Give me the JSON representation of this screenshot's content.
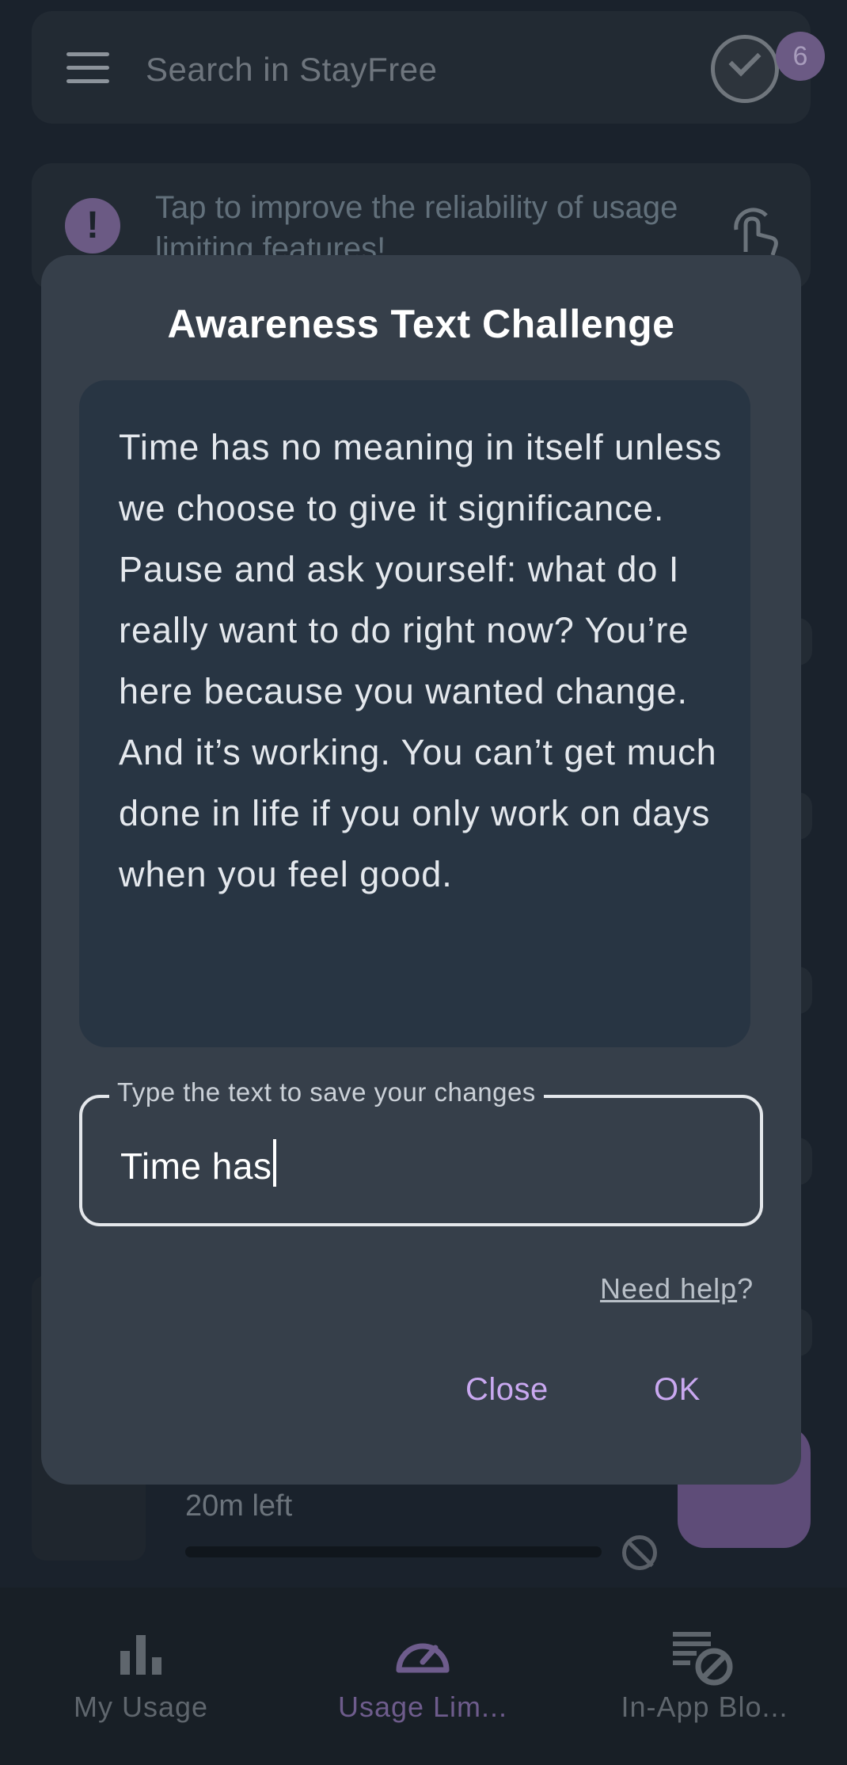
{
  "search": {
    "placeholder": "Search in StayFree",
    "badge_count": "6"
  },
  "banner": {
    "text": "Tap to improve the reliability of usage limiting features!"
  },
  "background_row": {
    "time_left": "20m left"
  },
  "dialog": {
    "title": "Awareness Text Challenge",
    "quote": "Time has no meaning in itself unless we choose to give it significance. Pause and ask yourself: what do I really want to do right now? You’re here because you wanted change. And it’s working. You can’t get much done in life if you only work on days when you feel good.",
    "field_label": "Type the text to save your changes",
    "field_value": "Time has",
    "help_link": "Need help",
    "help_suffix": "?",
    "close_label": "Close",
    "ok_label": "OK"
  },
  "bottom_nav": {
    "items": [
      {
        "label": "My Usage",
        "icon": "bar-chart-icon"
      },
      {
        "label": "Usage Lim...",
        "icon": "speedometer-icon",
        "active": true
      },
      {
        "label": "In-App Blo...",
        "icon": "list-block-icon"
      }
    ]
  },
  "colors": {
    "accent": "#c9a8f0",
    "dialog_bg": "#363f4a",
    "quote_bg": "#283543"
  }
}
